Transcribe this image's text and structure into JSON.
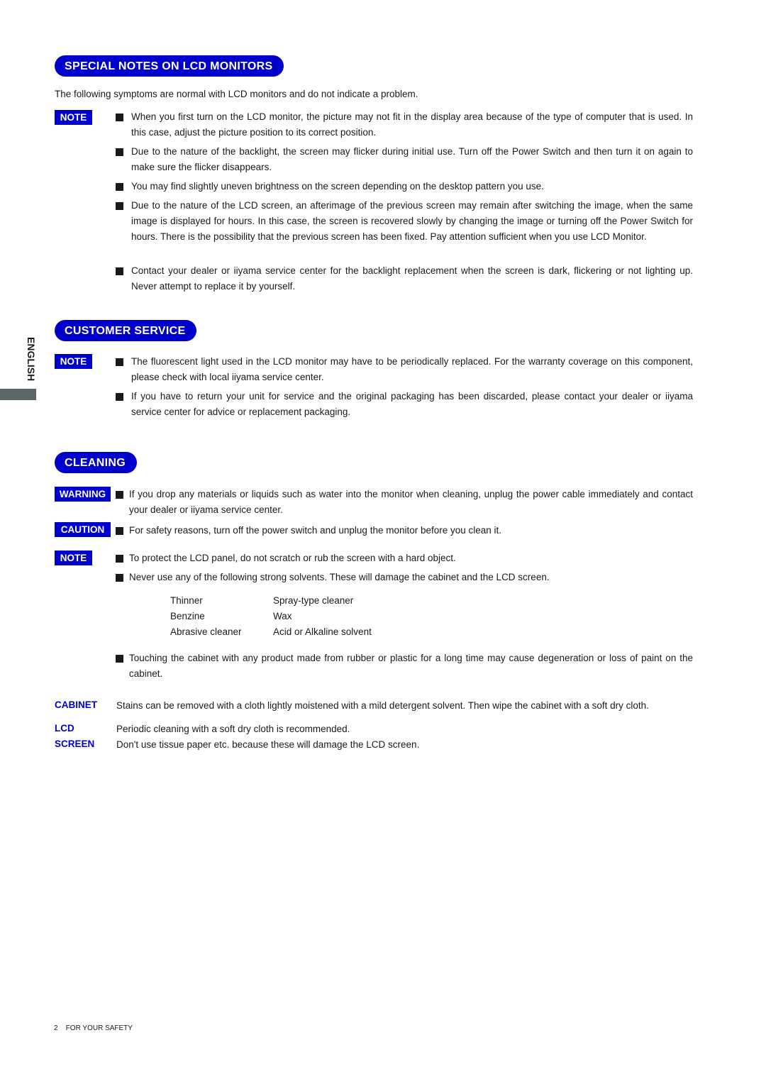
{
  "sidebar": {
    "language": "ENGLISH"
  },
  "sections": {
    "special_notes": {
      "title": "SPECIAL NOTES ON LCD MONITORS",
      "intro": "The following symptoms are normal with LCD monitors and do not indicate a problem.",
      "label": "NOTE",
      "items": [
        "When you first turn on the LCD monitor, the picture may not fit in the display area because of the type of computer that is used. In this case, adjust the picture position to its correct position.",
        "Due to the nature of the backlight, the screen may flicker during initial use. Turn off the Power Switch and then turn it on again to make sure the flicker disappears.",
        "You may find slightly uneven brightness on the screen depending on the desktop pattern you use.",
        "Due to the nature of the LCD screen, an afterimage of the previous screen may remain after switching the image, when the same image is displayed for hours. In this case, the screen is recovered slowly by changing the image or turning off the Power Switch for hours. There is the possibility that the previous screen has been fixed. Pay attention sufficient when you use LCD Monitor.",
        "Contact your dealer or iiyama service center for the backlight replacement when the screen is dark, flickering or not lighting up. Never attempt to replace it by yourself."
      ]
    },
    "customer_service": {
      "title": "CUSTOMER SERVICE",
      "label": "NOTE",
      "items": [
        "The fluorescent light used in the LCD monitor may have to be periodically replaced. For the warranty coverage on this component, please check with local iiyama service center.",
        "If you have to return your unit for service and the original packaging has been discarded, please contact your dealer or iiyama service center for advice or replacement packaging."
      ]
    },
    "cleaning": {
      "title": "CLEANING",
      "warning_label": "WARNING",
      "warning_item": "If you drop any materials or liquids such as water into the monitor when cleaning, unplug the power cable immediately and contact your dealer or iiyama service center.",
      "caution_label": "CAUTION",
      "caution_item": "For safety reasons, turn off the power switch and unplug the monitor before you clean it.",
      "note_label": "NOTE",
      "note_items": [
        "To protect the LCD panel, do not scratch or rub the screen with a hard object.",
        "Never use any of the following strong solvents. These will damage the cabinet and the LCD screen.",
        "Touching the cabinet with any product made from rubber or plastic for a long time may cause degeneration or loss of paint on the cabinet."
      ],
      "solvents": [
        [
          "Thinner",
          "Spray-type  cleaner"
        ],
        [
          "Benzine",
          "Wax"
        ],
        [
          "Abrasive  cleaner",
          "Acid or Alkaline solvent"
        ]
      ],
      "cabinet_label": "CABINET",
      "cabinet_text": "Stains can be removed with a cloth lightly moistened with a mild detergent solvent. Then wipe the cabinet with a soft dry cloth.",
      "lcd_label": "LCD",
      "screen_label": "SCREEN",
      "lcd_text_1": "Periodic cleaning with a soft dry cloth is recommended.",
      "lcd_text_2": "Don't use tissue paper etc. because these will damage the LCD screen."
    }
  },
  "footer": {
    "page_number": "2",
    "section": "FOR YOUR SAFETY"
  }
}
